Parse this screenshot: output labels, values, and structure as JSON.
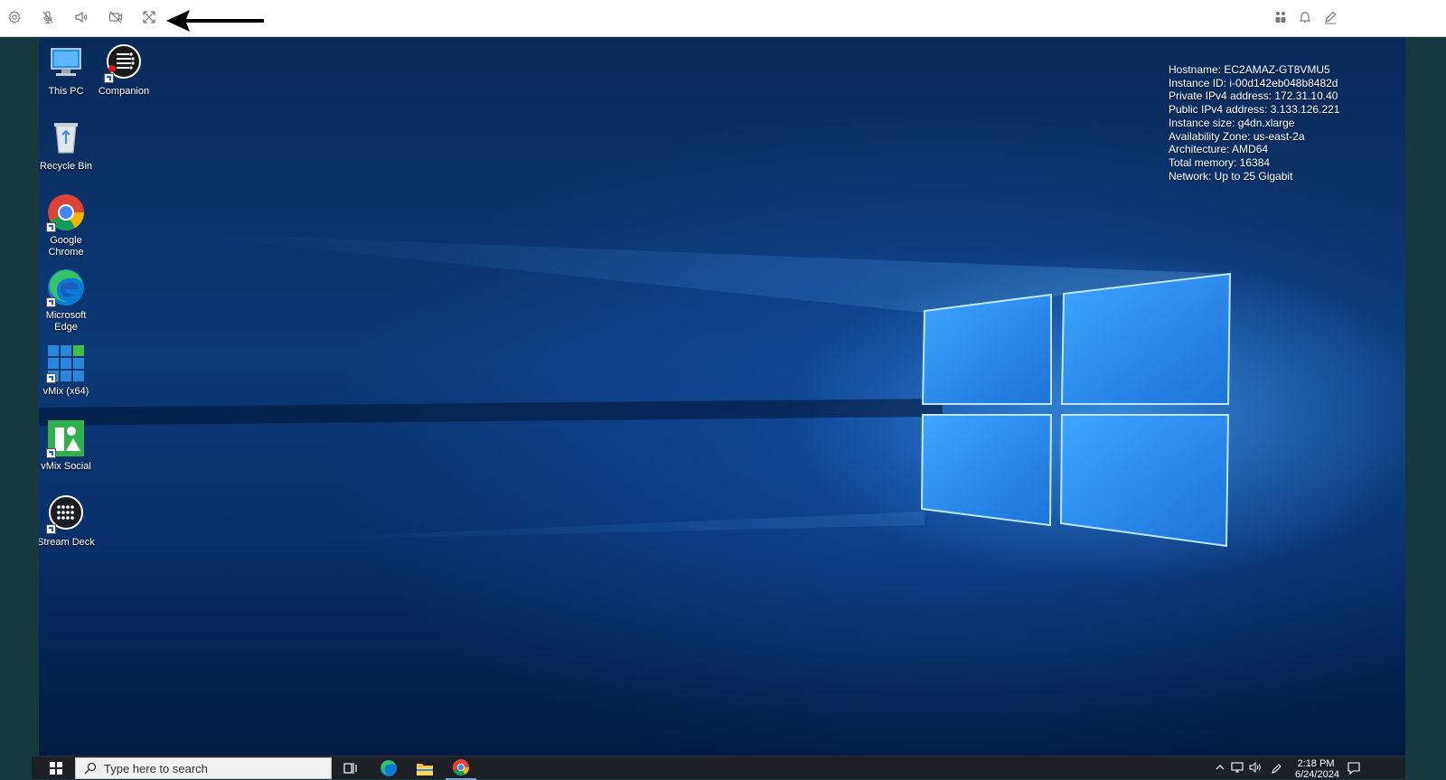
{
  "toolbar": {
    "left_icons": [
      "gear-icon",
      "mic-muted-icon",
      "speaker-icon",
      "camera-off-icon",
      "fullscreen-icon"
    ],
    "right_icons": [
      "people-icon",
      "bell-icon",
      "pen-icon"
    ]
  },
  "desktop": {
    "icons": [
      {
        "label": "This PC",
        "icon": "this-pc-icon"
      },
      {
        "label": "Companion",
        "icon": "companion-icon"
      },
      {
        "label": "Recycle Bin",
        "icon": "recycle-bin-icon"
      },
      {
        "label": "Google Chrome",
        "icon": "chrome-icon"
      },
      {
        "label": "Microsoft Edge",
        "icon": "edge-icon"
      },
      {
        "label": "vMix (x64)",
        "icon": "vmix-icon"
      },
      {
        "label": "vMix Social",
        "icon": "vmix-social-icon"
      },
      {
        "label": "Stream Deck",
        "icon": "stream-deck-icon"
      }
    ],
    "sysinfo": [
      "Hostname: EC2AMAZ-GT8VMU5",
      "Instance ID: i-00d142eb048b8482d",
      "Private IPv4 address: 172.31.10.40",
      "Public IPv4 address: 3.133.126.221",
      "Instance size: g4dn.xlarge",
      "Availability Zone: us-east-2a",
      "Architecture: AMD64",
      "Total memory: 16384",
      "Network: Up to 25 Gigabit"
    ]
  },
  "taskbar": {
    "search_placeholder": "Type here to search",
    "time": "2:18 PM",
    "date": "6/24/2024",
    "pinned": [
      "task-view-icon",
      "edge-icon",
      "file-explorer-icon",
      "chrome-icon"
    ]
  },
  "colors": {
    "accent": "#1a78d8",
    "taskbar": "#1d2126",
    "frame": "#17383f"
  }
}
